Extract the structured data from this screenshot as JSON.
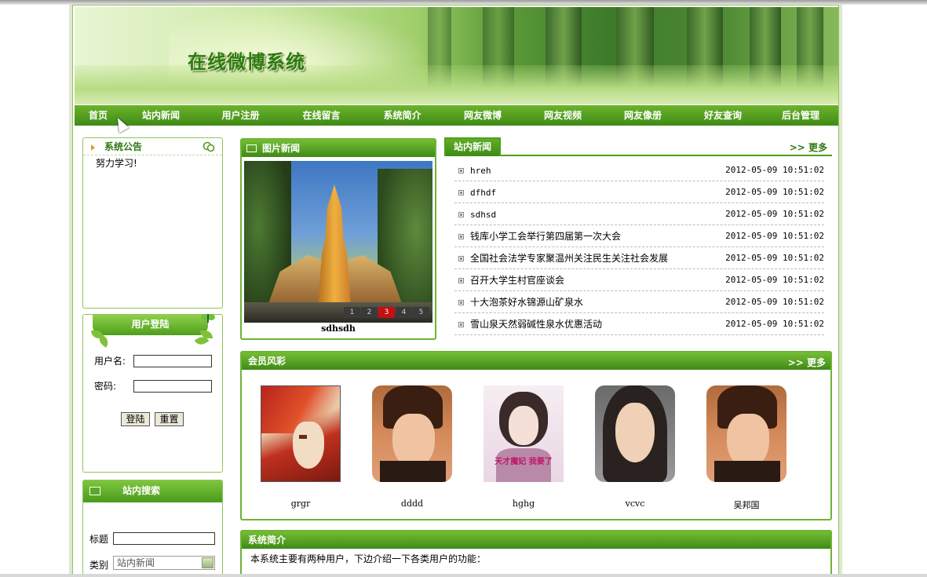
{
  "site": {
    "title": "在线微博系统"
  },
  "nav": {
    "items": [
      "首页",
      "站内新闻",
      "用户注册",
      "在线留言",
      "系统简介",
      "网友微博",
      "网友视频",
      "网友像册",
      "好友查询",
      "后台管理"
    ]
  },
  "notice": {
    "title": "系统公告",
    "content": "努力学习!"
  },
  "login": {
    "title": "用户登陆",
    "username_label": "用户名:",
    "password_label": "密码:",
    "login_button": "登陆",
    "reset_button": "重置"
  },
  "search": {
    "title": "站内搜索",
    "title_label": "标题",
    "category_label": "类别",
    "category_value": "站内新闻"
  },
  "picnews": {
    "title": "图片新闻",
    "caption": "sdhsdh",
    "pages": [
      "1",
      "2",
      "3",
      "4",
      "5"
    ],
    "active_page": "3"
  },
  "news": {
    "title": "站内新闻",
    "more": ">> 更多",
    "items": [
      {
        "title": "hreh",
        "date": "2012-05-09 10:51:02"
      },
      {
        "title": "dfhdf",
        "date": "2012-05-09 10:51:02"
      },
      {
        "title": "sdhsd",
        "date": "2012-05-09 10:51:02"
      },
      {
        "title": "钱库小学工会举行第四届第一次大会",
        "date": "2012-05-09 10:51:02"
      },
      {
        "title": "全国社会法学专家聚温州关注民生关注社会发展",
        "date": "2012-05-09 10:51:02"
      },
      {
        "title": "召开大学生村官座谈会",
        "date": "2012-05-09 10:51:02"
      },
      {
        "title": "十大泡茶好水锦源山矿泉水",
        "date": "2012-05-09 10:51:02"
      },
      {
        "title": "雪山泉天然弱碱性泉水优惠活动",
        "date": "2012-05-09 10:51:02"
      }
    ]
  },
  "members": {
    "title": "会员风彩",
    "more": ">> 更多",
    "items": [
      {
        "name": "grgr",
        "avatar": "anime-red-hair-portrait"
      },
      {
        "name": "dddd",
        "avatar": "young-man-portrait"
      },
      {
        "name": "hghg",
        "avatar": "anime-girl-portrait",
        "overlay_text": "天才魔妃 我要了"
      },
      {
        "name": "vcvc",
        "avatar": "young-woman-portrait"
      },
      {
        "name": "吴邦国",
        "avatar": "young-man-portrait"
      }
    ]
  },
  "intro": {
    "title": "系统简介",
    "text": "本系统主要有两种用户，下边介绍一下各类用户的功能："
  },
  "colors": {
    "green_dark": "#3f8a16",
    "green_light": "#74bd34",
    "accent_title": "#2f7a12"
  }
}
